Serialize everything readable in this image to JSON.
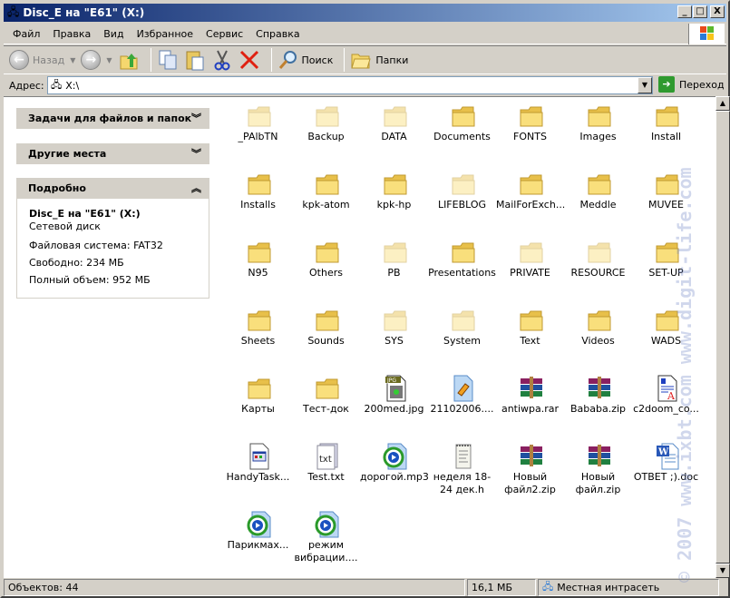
{
  "window": {
    "title": "Disc_E на \"E61\" (X:)",
    "min": "_",
    "max": "□",
    "close": "X"
  },
  "menu": [
    "Файл",
    "Правка",
    "Вид",
    "Избранное",
    "Сервис",
    "Справка"
  ],
  "toolbar": {
    "back": "Назад",
    "search": "Поиск",
    "folders": "Папки"
  },
  "address": {
    "label": "Адрес:",
    "value": "X:\\",
    "go": "Переход"
  },
  "left_panel": {
    "tasks": "Задачи для файлов и папок",
    "other": "Другие места",
    "details": {
      "header": "Подробно",
      "name": "Disc_E на \"E61\" (X:)",
      "type": "Сетевой диск",
      "fs": "Файловая система: FAT32",
      "free": "Свободно: 234 МБ",
      "total": "Полный объем: 952 МБ"
    }
  },
  "files": [
    {
      "name": "_PAlbTN",
      "icon": "folder",
      "hidden": true
    },
    {
      "name": "Backup",
      "icon": "folder",
      "hidden": true
    },
    {
      "name": "DATA",
      "icon": "folder",
      "hidden": true
    },
    {
      "name": "Documents",
      "icon": "folder"
    },
    {
      "name": "FONTS",
      "icon": "folder"
    },
    {
      "name": "Images",
      "icon": "folder"
    },
    {
      "name": "Install",
      "icon": "folder"
    },
    {
      "name": "Installs",
      "icon": "folder"
    },
    {
      "name": "kpk-atom",
      "icon": "folder"
    },
    {
      "name": "kpk-hp",
      "icon": "folder"
    },
    {
      "name": "LIFEBLOG",
      "icon": "folder",
      "hidden": true
    },
    {
      "name": "MailForExch...",
      "icon": "folder"
    },
    {
      "name": "Meddle",
      "icon": "folder"
    },
    {
      "name": "MUVEE",
      "icon": "folder"
    },
    {
      "name": "N95",
      "icon": "folder"
    },
    {
      "name": "Others",
      "icon": "folder"
    },
    {
      "name": "PB",
      "icon": "folder",
      "hidden": true
    },
    {
      "name": "Presentations",
      "icon": "folder"
    },
    {
      "name": "PRIVATE",
      "icon": "folder",
      "hidden": true
    },
    {
      "name": "RESOURCE",
      "icon": "folder",
      "hidden": true
    },
    {
      "name": "SET-UP",
      "icon": "folder"
    },
    {
      "name": "Sheets",
      "icon": "folder"
    },
    {
      "name": "Sounds",
      "icon": "folder"
    },
    {
      "name": "SYS",
      "icon": "folder",
      "hidden": true
    },
    {
      "name": "System",
      "icon": "folder",
      "hidden": true
    },
    {
      "name": "Text",
      "icon": "folder"
    },
    {
      "name": "Videos",
      "icon": "folder"
    },
    {
      "name": "WADS",
      "icon": "folder"
    },
    {
      "name": "Карты",
      "icon": "folder"
    },
    {
      "name": "Тест-док",
      "icon": "folder"
    },
    {
      "name": "200med.jpg",
      "icon": "jpg"
    },
    {
      "name": "21102006....",
      "icon": "media-file"
    },
    {
      "name": "antiwpa.rar",
      "icon": "archive"
    },
    {
      "name": "Bababa.zip",
      "icon": "archive"
    },
    {
      "name": "c2doom_co...",
      "icon": "document"
    },
    {
      "name": "HandyTask...",
      "icon": "app"
    },
    {
      "name": "Test.txt",
      "icon": "txt"
    },
    {
      "name": "дорогой.mp3",
      "icon": "audio"
    },
    {
      "name": "неделя 18-24 дек.h",
      "icon": "notepad"
    },
    {
      "name": "Новый файл2.zip",
      "icon": "archive"
    },
    {
      "name": "Новый файл.zip",
      "icon": "archive"
    },
    {
      "name": "ОТВЕТ ;).doc",
      "icon": "word"
    },
    {
      "name": "Парикмах...",
      "icon": "audio"
    },
    {
      "name": "режим вибрации....",
      "icon": "audio"
    }
  ],
  "status": {
    "objects": "Объектов: 44",
    "size": "16,1 МБ",
    "zone": "Местная интрасеть"
  },
  "watermark": "© 2007 www.ixbt.com www.digit-life.com",
  "colors": {
    "titlebar": "#0a246a",
    "folder": "#f5d76e"
  }
}
